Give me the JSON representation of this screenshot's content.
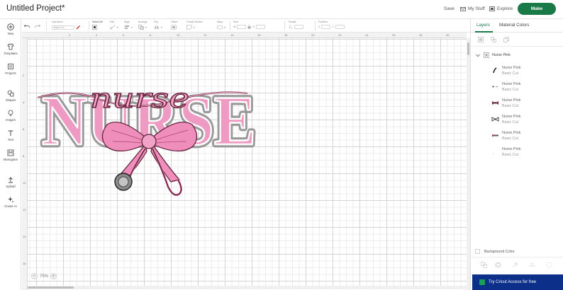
{
  "header": {
    "title": "Untitled Project*",
    "save": "Save",
    "my_stuff": "My Stuff",
    "explore": "Explore",
    "make": "Make"
  },
  "sidebar": {
    "items": [
      {
        "label": "New",
        "icon": "plus-circle-icon"
      },
      {
        "label": "Templates",
        "icon": "shirt-icon"
      },
      {
        "label": "Projects",
        "icon": "folder-icon"
      },
      {
        "label": "Shapes",
        "icon": "shapes-icon"
      },
      {
        "label": "Images",
        "icon": "lightbulb-icon"
      },
      {
        "label": "Text",
        "icon": "text-t-icon"
      },
      {
        "label": "Monogram",
        "icon": "monogram-icon"
      },
      {
        "label": "Upload",
        "icon": "upload-icon"
      },
      {
        "label": "Create AI",
        "icon": "sparkle-icon"
      }
    ]
  },
  "toolbar": {
    "operation_label": "Operation",
    "operation_value": "Basic Cut",
    "select_all": "Select All",
    "edit": "Edit",
    "align": "Align",
    "arrange": "Arrange",
    "flip": "Flip",
    "offset": "Offset",
    "create_sticker": "Create Sticker",
    "warp": "Warp",
    "size": "Size",
    "size_w": "W",
    "size_h": "H",
    "rotate": "Rotate",
    "position": "Position",
    "pos_x": "X",
    "pos_y": "Y"
  },
  "ruler": {
    "top": [
      "2",
      "4",
      "6",
      "8",
      "10",
      "12",
      "14",
      "16",
      "18",
      "20",
      "22",
      "24",
      "26",
      "28",
      "30",
      "32"
    ],
    "left": [
      "2",
      "4",
      "6",
      "8",
      "10",
      "12",
      "14",
      "16"
    ]
  },
  "canvas": {
    "zoom": "75%",
    "zoom_out": "−",
    "zoom_in": "+",
    "design_text": "NURSE",
    "script_text": "nurse"
  },
  "panel": {
    "tab_layers": "Layers",
    "tab_colors": "Material Colors",
    "group_name": "Nurse Pink",
    "layers": [
      {
        "name": "Nurse Pink",
        "type": "Basic Cut",
        "color": "#222222"
      },
      {
        "name": "Nurse Pink",
        "type": "Basic Cut",
        "color": "#444444"
      },
      {
        "name": "Nurse Pink",
        "type": "Basic Cut",
        "color": "#7a2a3a"
      },
      {
        "name": "Nurse Pink",
        "type": "Basic Cut",
        "color": "#333333"
      },
      {
        "name": "Nurse Pink",
        "type": "Basic Cut",
        "color": "#5a5a5a"
      },
      {
        "name": "Nurse Pink",
        "type": "Basic Cut",
        "color": "#dddddd"
      }
    ],
    "background_color": "Background Color",
    "access_button": "Try Cricut Access for free"
  },
  "colors": {
    "brand_green": "#1a7a47",
    "pink": "#ef9ac3",
    "access_blue": "#0c2f8a"
  }
}
